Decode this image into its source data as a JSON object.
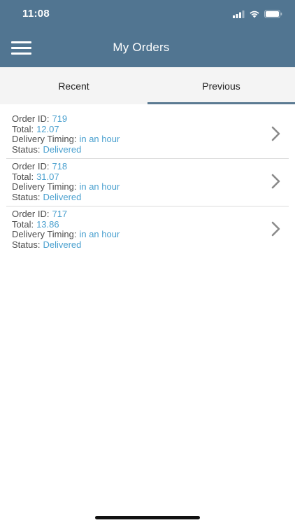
{
  "status_bar": {
    "time": "11:08"
  },
  "header": {
    "title": "My Orders",
    "background": "#517591"
  },
  "tabs": [
    {
      "label": "Recent",
      "active": false
    },
    {
      "label": "Previous",
      "active": true
    }
  ],
  "field_labels": {
    "order_id": "Order ID:",
    "total": "Total:",
    "delivery_timing": "Delivery Timing:",
    "status": "Status:"
  },
  "orders": [
    {
      "order_id": "719",
      "total": "12.07",
      "delivery_timing": "in an hour",
      "status": "Delivered"
    },
    {
      "order_id": "718",
      "total": "31.07",
      "delivery_timing": "in an hour",
      "status": "Delivered"
    },
    {
      "order_id": "717",
      "total": "13.86",
      "delivery_timing": "in an hour",
      "status": "Delivered"
    }
  ],
  "colors": {
    "accent_value": "#4aa0cf",
    "label_text": "#4c4c4c",
    "tab_indicator": "#5b7a92"
  },
  "icons": {
    "menu": "hamburger-menu-icon",
    "row_action": "chevron-right-icon",
    "signal": "cellular-signal-icon",
    "wifi": "wifi-icon",
    "battery": "battery-icon"
  }
}
